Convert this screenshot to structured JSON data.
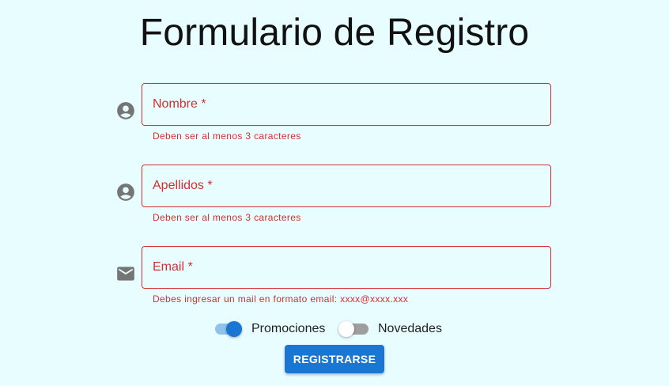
{
  "form": {
    "title": "Formulario de Registro",
    "fields": [
      {
        "label": "Nombre *",
        "helper": "Deben ser al menos 3 caracteres",
        "icon": "account-circle-icon"
      },
      {
        "label": "Apellidos *",
        "helper": "Deben ser al menos 3 caracteres",
        "icon": "account-circle-icon"
      },
      {
        "label": "Email *",
        "helper": "Debes ingresar un mail en formato email: xxxx@xxxx.xxx",
        "icon": "email-icon"
      }
    ],
    "switches": [
      {
        "label": "Promociones",
        "checked": true
      },
      {
        "label": "Novedades",
        "checked": false
      }
    ],
    "submit_label": "REGISTRARSE"
  },
  "colors": {
    "background": "#e8fdff",
    "error": "#d32f2f",
    "primary": "#1976d2",
    "icon": "#757575"
  }
}
